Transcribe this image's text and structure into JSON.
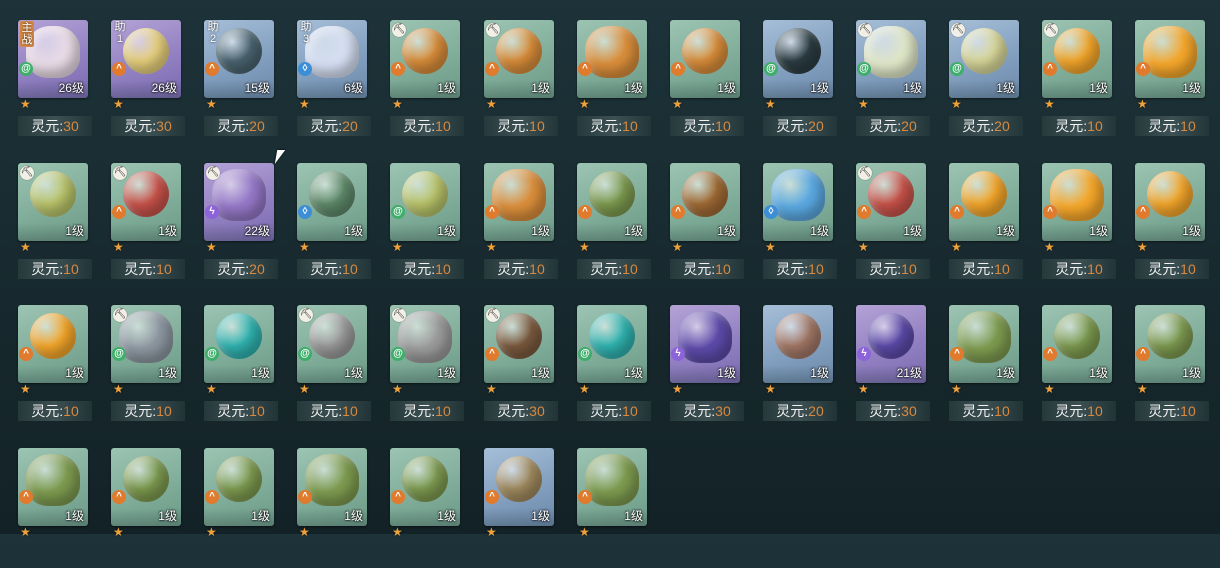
{
  "labels": {
    "cost_prefix": "灵元:",
    "level_suffix": "级"
  },
  "cards": [
    {
      "badge": "主战",
      "tool": false,
      "element": "wind",
      "level": "26",
      "cost": "30",
      "bg": "purple",
      "color": "#e9dbe6"
    },
    {
      "badge": "助1",
      "tool": false,
      "element": "fire",
      "level": "26",
      "cost": "30",
      "bg": "purple",
      "color": "#e7d07c"
    },
    {
      "badge": "助2",
      "tool": false,
      "element": "fire",
      "level": "15",
      "cost": "20",
      "bg": "blue",
      "color": "#4a6470"
    },
    {
      "badge": "助3",
      "tool": false,
      "element": "water",
      "level": "6",
      "cost": "20",
      "bg": "blue",
      "color": "#d5dff2"
    },
    {
      "badge": "",
      "tool": true,
      "element": "fire",
      "level": "1",
      "cost": "10",
      "bg": "teal",
      "color": "#d98d3a"
    },
    {
      "badge": "",
      "tool": true,
      "element": "fire",
      "level": "1",
      "cost": "10",
      "bg": "teal",
      "color": "#d98d3a"
    },
    {
      "badge": "",
      "tool": false,
      "element": "fire",
      "level": "1",
      "cost": "10",
      "bg": "teal",
      "color": "#d98d3a"
    },
    {
      "badge": "",
      "tool": false,
      "element": "fire",
      "level": "1",
      "cost": "10",
      "bg": "teal",
      "color": "#d98d3a"
    },
    {
      "badge": "",
      "tool": false,
      "element": "wind",
      "level": "1",
      "cost": "20",
      "bg": "blue",
      "color": "#2b3c42"
    },
    {
      "badge": "",
      "tool": true,
      "element": "wind",
      "level": "1",
      "cost": "20",
      "bg": "blue",
      "color": "#dfe6c7"
    },
    {
      "badge": "",
      "tool": true,
      "element": "wind",
      "level": "1",
      "cost": "20",
      "bg": "blue",
      "color": "#d9d89a"
    },
    {
      "badge": "",
      "tool": true,
      "element": "fire",
      "level": "1",
      "cost": "10",
      "bg": "teal",
      "color": "#f4a62a"
    },
    {
      "badge": "",
      "tool": false,
      "element": "fire",
      "level": "1",
      "cost": "10",
      "bg": "teal",
      "color": "#f4a62a"
    },
    {
      "badge": "",
      "tool": true,
      "element": "",
      "level": "1",
      "cost": "10",
      "bg": "teal",
      "color": "#b9c46a"
    },
    {
      "badge": "",
      "tool": true,
      "element": "fire",
      "level": "1",
      "cost": "10",
      "bg": "teal",
      "color": "#c9534a"
    },
    {
      "badge": "",
      "tool": true,
      "element": "thunder",
      "level": "22",
      "cost": "20",
      "bg": "purple",
      "color": "#9477c6"
    },
    {
      "badge": "",
      "tool": false,
      "element": "water",
      "level": "1",
      "cost": "10",
      "bg": "teal",
      "color": "#5e8a6a"
    },
    {
      "badge": "",
      "tool": false,
      "element": "wind",
      "level": "1",
      "cost": "10",
      "bg": "teal",
      "color": "#b9c46a"
    },
    {
      "badge": "",
      "tool": false,
      "element": "fire",
      "level": "1",
      "cost": "10",
      "bg": "teal",
      "color": "#d98d3a"
    },
    {
      "badge": "",
      "tool": false,
      "element": "fire",
      "level": "1",
      "cost": "10",
      "bg": "teal",
      "color": "#7d9a4f"
    },
    {
      "badge": "",
      "tool": false,
      "element": "fire",
      "level": "1",
      "cost": "10",
      "bg": "teal",
      "color": "#a06a34"
    },
    {
      "badge": "",
      "tool": false,
      "element": "water",
      "level": "1",
      "cost": "10",
      "bg": "teal",
      "color": "#5aa8e0"
    },
    {
      "badge": "",
      "tool": true,
      "element": "fire",
      "level": "1",
      "cost": "10",
      "bg": "teal",
      "color": "#c9534a"
    },
    {
      "badge": "",
      "tool": false,
      "element": "fire",
      "level": "1",
      "cost": "10",
      "bg": "teal",
      "color": "#f4a62a"
    },
    {
      "badge": "",
      "tool": false,
      "element": "fire",
      "level": "1",
      "cost": "10",
      "bg": "teal",
      "color": "#f4a62a"
    },
    {
      "badge": "",
      "tool": false,
      "element": "fire",
      "level": "1",
      "cost": "10",
      "bg": "teal",
      "color": "#f4a62a"
    },
    {
      "badge": "",
      "tool": false,
      "element": "fire",
      "level": "1",
      "cost": "10",
      "bg": "teal",
      "color": "#f4a62a"
    },
    {
      "badge": "",
      "tool": true,
      "element": "wind",
      "level": "1",
      "cost": "10",
      "bg": "teal",
      "color": "#8c96a0"
    },
    {
      "badge": "",
      "tool": false,
      "element": "wind",
      "level": "1",
      "cost": "10",
      "bg": "teal",
      "color": "#2fb3b0"
    },
    {
      "badge": "",
      "tool": true,
      "element": "wind",
      "level": "1",
      "cost": "10",
      "bg": "teal",
      "color": "#9a9a9a"
    },
    {
      "badge": "",
      "tool": true,
      "element": "wind",
      "level": "1",
      "cost": "10",
      "bg": "teal",
      "color": "#9a9a9a"
    },
    {
      "badge": "",
      "tool": true,
      "element": "fire",
      "level": "1",
      "cost": "30",
      "bg": "teal",
      "color": "#7b5a3e"
    },
    {
      "badge": "",
      "tool": false,
      "element": "wind",
      "level": "1",
      "cost": "10",
      "bg": "teal",
      "color": "#2fb3b0"
    },
    {
      "badge": "",
      "tool": false,
      "element": "thunder",
      "level": "1",
      "cost": "30",
      "bg": "purple",
      "color": "#5c4aa8"
    },
    {
      "badge": "",
      "tool": false,
      "element": "",
      "level": "1",
      "cost": "20",
      "bg": "blue",
      "color": "#a27766"
    },
    {
      "badge": "",
      "tool": false,
      "element": "thunder",
      "level": "21",
      "cost": "30",
      "bg": "purple",
      "color": "#5c4aa8"
    },
    {
      "badge": "",
      "tool": false,
      "element": "fire",
      "level": "1",
      "cost": "10",
      "bg": "teal",
      "color": "#7d9a4f"
    },
    {
      "badge": "",
      "tool": false,
      "element": "fire",
      "level": "1",
      "cost": "10",
      "bg": "teal",
      "color": "#7d9a4f"
    },
    {
      "badge": "",
      "tool": false,
      "element": "fire",
      "level": "1",
      "cost": "10",
      "bg": "teal",
      "color": "#7d9a4f"
    },
    {
      "badge": "",
      "tool": false,
      "element": "fire",
      "level": "1",
      "cost": "",
      "bg": "teal",
      "color": "#7d9a4f"
    },
    {
      "badge": "",
      "tool": false,
      "element": "fire",
      "level": "1",
      "cost": "",
      "bg": "teal",
      "color": "#7d9a4f"
    },
    {
      "badge": "",
      "tool": false,
      "element": "fire",
      "level": "1",
      "cost": "",
      "bg": "teal",
      "color": "#7d9a4f"
    },
    {
      "badge": "",
      "tool": false,
      "element": "fire",
      "level": "1",
      "cost": "",
      "bg": "teal",
      "color": "#7d9a4f"
    },
    {
      "badge": "",
      "tool": false,
      "element": "fire",
      "level": "1",
      "cost": "",
      "bg": "teal",
      "color": "#7d9a4f"
    },
    {
      "badge": "",
      "tool": false,
      "element": "fire",
      "level": "1",
      "cost": "",
      "bg": "blue",
      "color": "#a08a5e"
    },
    {
      "badge": "",
      "tool": false,
      "element": "fire",
      "level": "1",
      "cost": "",
      "bg": "teal",
      "color": "#7d9a4f"
    }
  ]
}
